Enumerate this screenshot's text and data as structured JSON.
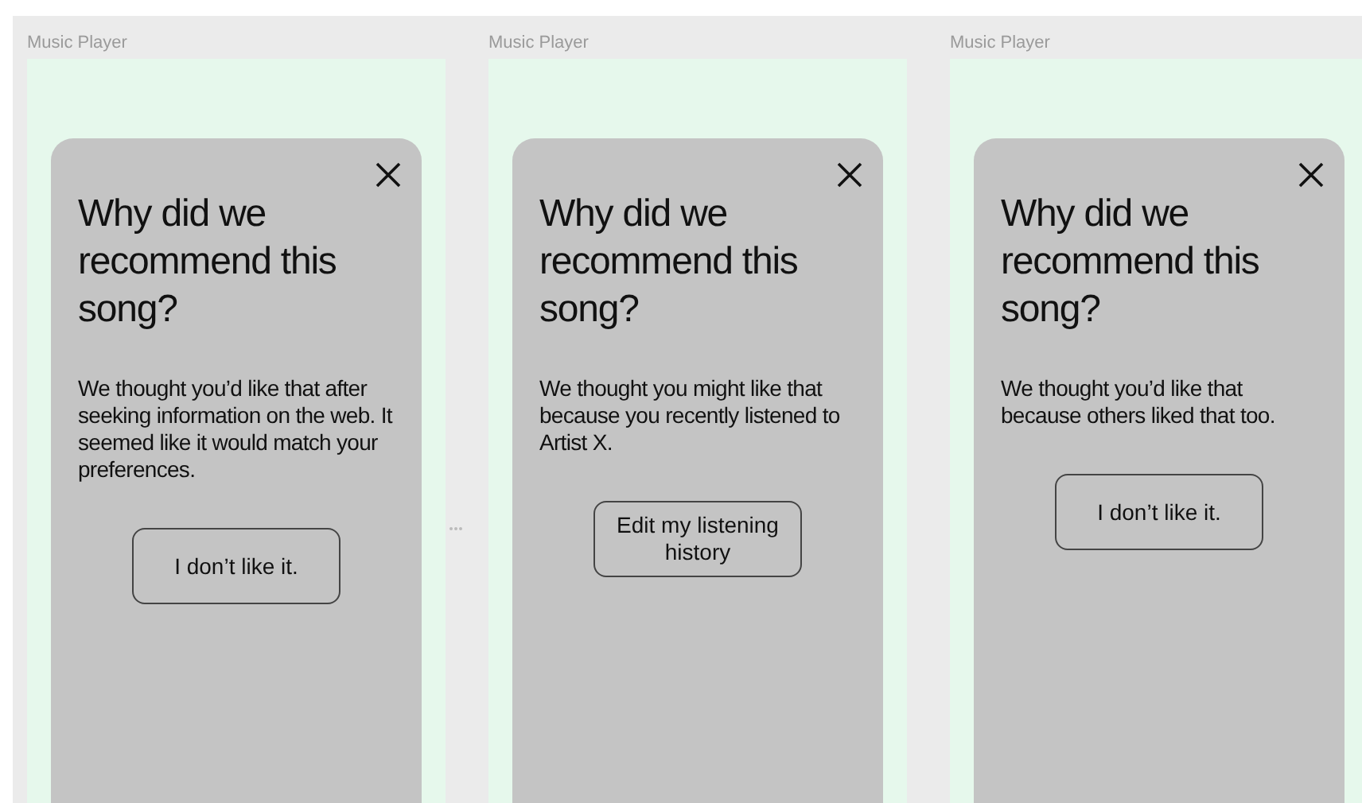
{
  "frames": [
    {
      "label": "Music Player",
      "dialog": {
        "title": "Why did we recommend this song?",
        "body": "We thought you’d like that after seeking information on the web. It seemed like it would match your preferences.",
        "button": "I don’t like it."
      }
    },
    {
      "label": "Music Player",
      "dialog": {
        "title": "Why did we recommend this song?",
        "body": "We thought you might like that because you recently listened to Artist X.",
        "button": "Edit my listening history"
      }
    },
    {
      "label": "Music Player",
      "dialog": {
        "title": "Why did we recommend this song?",
        "body": "We thought you’d like that because others liked that too.",
        "button": "I don’t like it."
      }
    }
  ]
}
